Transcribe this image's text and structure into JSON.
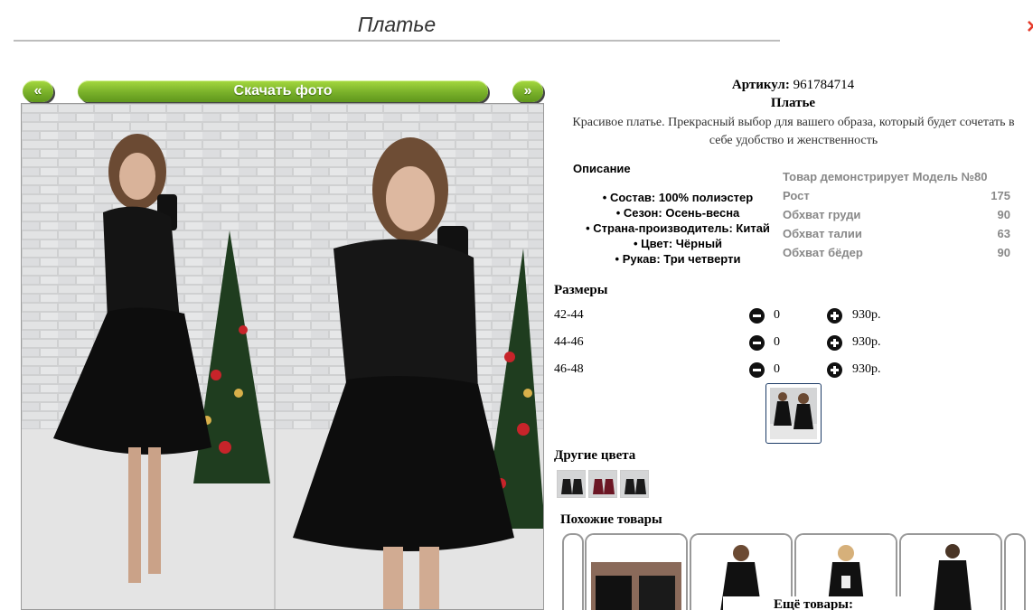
{
  "header": {
    "title": "Платье",
    "close_glyph": "×"
  },
  "gallery": {
    "prev_label": "«",
    "download_label": "Скачать фото",
    "next_label": "»"
  },
  "product": {
    "sku_label": "Артикул:",
    "sku_value": "961784714",
    "name": "Платье",
    "description": "Красивое платье. Прекрасный выбор для вашего образа, который будет сочетать в себе удобство и женственность",
    "spec_heading": "Описание",
    "specs": [
      "Состав: 100% полиэстер",
      "Сезон: Осень-весна",
      "Страна-производитель: Китай",
      "Цвет: Чёрный",
      "Рукав: Три четверти"
    ]
  },
  "model": {
    "heading": "Товар демонстрирует Модель №80",
    "rows": [
      {
        "label": "Рост",
        "value": "175"
      },
      {
        "label": "Обхват груди",
        "value": "90"
      },
      {
        "label": "Обхват талии",
        "value": "63"
      },
      {
        "label": "Обхват бёдер",
        "value": "90"
      }
    ]
  },
  "sizes": {
    "heading": "Размеры",
    "rows": [
      {
        "size": "42-44",
        "qty": "0",
        "price": "930р."
      },
      {
        "size": "44-46",
        "qty": "0",
        "price": "930р."
      },
      {
        "size": "46-48",
        "qty": "0",
        "price": "930р."
      }
    ]
  },
  "other_colors": {
    "heading": "Другие цвета",
    "swatches": [
      "#1a1a1a",
      "#6b1624",
      "#1a1a1a"
    ]
  },
  "similar": {
    "heading": "Похожие товары",
    "more_label": "Ещё товары:"
  },
  "colors": {
    "accent_green": "#79b12a",
    "close_red": "#e53a2a",
    "thumb_border": "#1c3b66"
  }
}
